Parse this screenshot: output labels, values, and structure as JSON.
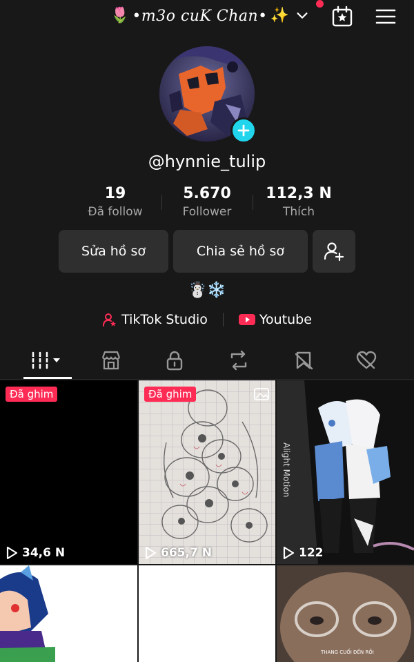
{
  "header": {
    "title": "•m3o cuK Chan•",
    "title_prefix_emoji": "🌷",
    "title_suffix_emoji": "✨",
    "notification_dot_color": "#fe2c55",
    "icons": [
      "chevron-down-icon",
      "calendar-star-icon",
      "menu-icon"
    ]
  },
  "profile": {
    "username": "@hynnie_tulip",
    "avatar_add_color": "#20d5ec"
  },
  "stats": [
    {
      "value": "19",
      "label": "Đã follow"
    },
    {
      "value": "5.670",
      "label": "Follower"
    },
    {
      "value": "112,3 N",
      "label": "Thích"
    }
  ],
  "actions": {
    "edit_label": "Sửa hồ sơ",
    "share_label": "Chia sẻ hồ sơ",
    "add_friend_icon": "add-user-icon"
  },
  "bio": "☃️❄️",
  "links": [
    {
      "label": "TikTok Studio",
      "icon": "studio-icon"
    },
    {
      "label": "Youtube",
      "icon": "youtube-icon"
    }
  ],
  "tabs": [
    {
      "icon": "grid-icon",
      "active": true
    },
    {
      "icon": "shop-icon"
    },
    {
      "icon": "lock-icon"
    },
    {
      "icon": "repost-icon"
    },
    {
      "icon": "bookmark-icon"
    },
    {
      "icon": "liked-icon"
    }
  ],
  "videos": [
    {
      "pinned": "Đã ghim",
      "views": "34,6 N"
    },
    {
      "pinned": "Đã ghim",
      "views": "665,7 N"
    },
    {
      "overlay_text": "Alight Motion",
      "views": "122"
    },
    {
      "views": ""
    },
    {
      "views": ""
    },
    {
      "overlay_text": "THANG CUỐI ĐẾN RỒI"
    }
  ],
  "colors": {
    "background": "#181818",
    "accent": "#fe2c55",
    "button": "#2f2f2f"
  }
}
